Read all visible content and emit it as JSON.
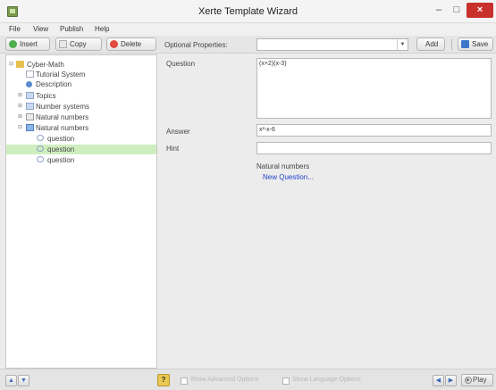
{
  "window": {
    "title": "Xerte Template Wizard",
    "minimize_glyph": "–",
    "maximize_glyph": "□",
    "close_glyph": "×"
  },
  "menu": {
    "items": [
      "File",
      "View",
      "Publish",
      "Help"
    ]
  },
  "toolbar": {
    "insert_label": "Insert",
    "copy_label": "Copy",
    "delete_label": "Delete",
    "optional_properties_label": "Optional Properties:",
    "optional_properties_value": "",
    "add_label": "Add",
    "save_label": "Save"
  },
  "tree": {
    "items": [
      {
        "label": "Cyber-Math",
        "icon": "folder-icon"
      },
      {
        "label": "Tutorial System",
        "icon": "page-icon"
      },
      {
        "label": "Description",
        "icon": "description-icon"
      },
      {
        "label": "Topics",
        "icon": "folder-icon"
      },
      {
        "label": "Number systems",
        "icon": "folder-icon"
      },
      {
        "label": "Natural numbers",
        "icon": "list-icon"
      },
      {
        "label": "Natural numbers",
        "icon": "list-icon"
      },
      {
        "label": "question",
        "icon": "question-icon"
      },
      {
        "label": "question",
        "icon": "question-icon"
      },
      {
        "label": "question",
        "icon": "question-icon"
      }
    ]
  },
  "properties": {
    "question_label": "Question",
    "question_value": "(x+2)(x-3)",
    "answer_label": "Answer",
    "answer_value": "x²-x-6",
    "hint_label": "Hint",
    "hint_value": "",
    "parent_text": "Natural numbers",
    "new_question_link": "New Question..."
  },
  "statusbar": {
    "up_glyph": "▲",
    "down_glyph": "▼",
    "help_glyph": "?",
    "show_advanced_label": "Show Advanced Options",
    "show_language_label": "Show Language Options",
    "prev_glyph": "◀",
    "next_glyph": "▶",
    "play_label": "Play"
  },
  "colors": {
    "selected_row": "#cfeec0",
    "link": "#2244cc",
    "close_button": "#c9302c"
  }
}
